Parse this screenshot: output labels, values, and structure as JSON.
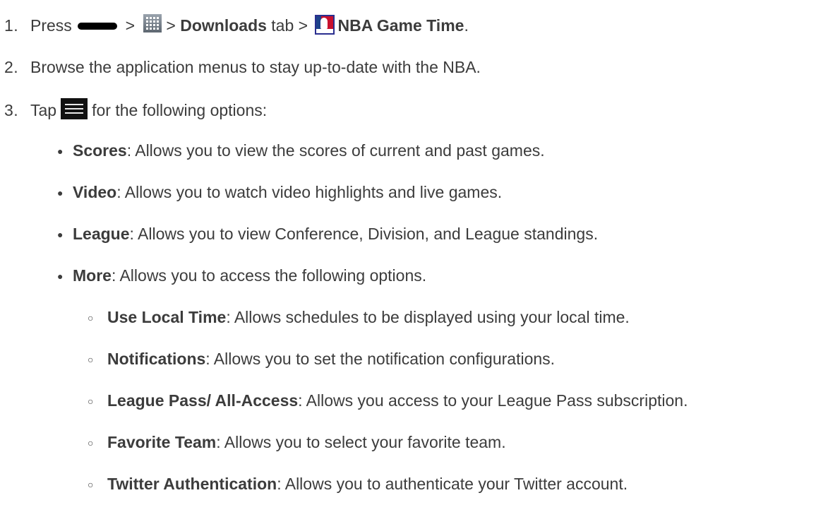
{
  "steps": [
    {
      "number": "1.",
      "parts": {
        "press": "Press",
        "sep1": ">",
        "sep2": ">",
        "downloads": "Downloads",
        "tab_text": "tab >",
        "app_name": "NBA Game Time",
        "end": "."
      }
    },
    {
      "number": "2.",
      "text": "Browse the application menus to stay up-to-date with the NBA."
    },
    {
      "number": "3.",
      "parts": {
        "tap": "Tap",
        "rest": "for the following options:"
      }
    }
  ],
  "options": [
    {
      "term": "Scores",
      "desc": ": Allows you to view the scores of current and past games."
    },
    {
      "term": "Video",
      "desc": ": Allows you to watch video highlights and live games."
    },
    {
      "term": "League",
      "desc": ": Allows you to view Conference, Division, and League standings."
    },
    {
      "term": "More",
      "desc": ": Allows you to access the following options."
    }
  ],
  "more_options": [
    {
      "term": "Use Local Time",
      "desc": ": Allows schedules to be displayed using your local time."
    },
    {
      "term": "Notifications",
      "desc": ": Allows you to set the notification configurations."
    },
    {
      "term": "League Pass/ All-Access",
      "desc": ": Allows you access to your League Pass subscription."
    },
    {
      "term": "Favorite Team",
      "desc": ": Allows you to select your favorite team."
    },
    {
      "term": "Twitter Authentication",
      "desc": ": Allows you to authenticate your Twitter account."
    }
  ],
  "icons": {
    "home_key": "home-key-icon",
    "apps": "apps-grid-icon",
    "nba_app": "nba-game-time-icon",
    "menu": "menu-icon"
  },
  "colors": {
    "text": "#3c3c3c",
    "nba_red": "#c8102e",
    "nba_blue": "#1d428a"
  }
}
